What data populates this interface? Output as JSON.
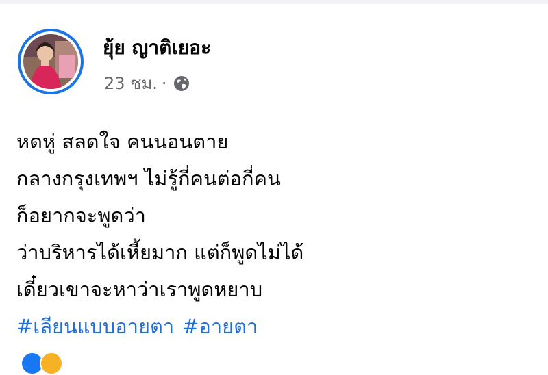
{
  "post": {
    "author_name": "ยุ้ย ญาติเยอะ",
    "timestamp": "23 ชม.",
    "separator": "·",
    "privacy_icon": "globe-icon",
    "text_lines": [
      "หดหู่ สลดใจ คนนอนตาย",
      "กลางกรุงเทพฯ ไม่รู้กี่คนต่อกี่คน",
      "ก็อยากจะพูดว่า",
      "ว่าบริหารได้เหี้ยมาก แต่ก็พูดไม่ได้",
      "เดี๋ยวเขาจะหาว่าเราพูดหยาบ"
    ],
    "hashtags": [
      "#เลียนแบบอายตา",
      "#อายตา"
    ],
    "reaction_icons": [
      "like-reaction-icon",
      "haha-reaction-icon"
    ]
  },
  "colors": {
    "avatar_ring": "#1b74e4",
    "hashtag": "#216fdb",
    "meta_text": "#65676b",
    "body_text": "#050505"
  }
}
